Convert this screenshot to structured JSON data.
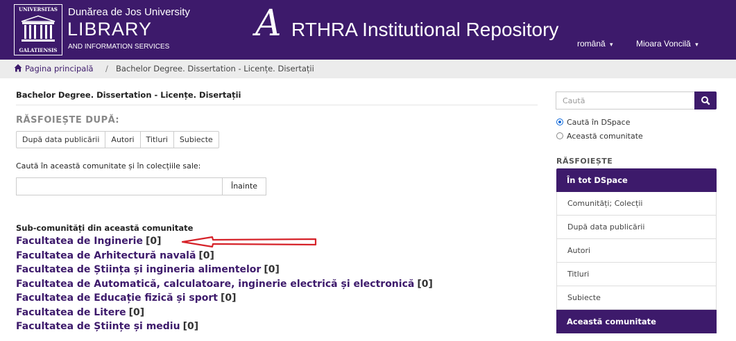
{
  "header": {
    "logo_top": "UNIVERSITAS",
    "logo_bottom": "GALATIENSIS",
    "university": "Dunărea de Jos University",
    "library": "LIBRARY",
    "subtitle": "AND INFORMATION SERVICES",
    "repo_initial": "A",
    "repo_rest": "RTHRA Institutional Repository",
    "language": "română",
    "user": "Mioara Voncilă",
    "caret": "▾"
  },
  "breadcrumb": {
    "home": "Pagina principală",
    "separator": "/",
    "current": "Bachelor Degree. Dissertation - Licențe. Disertații"
  },
  "main": {
    "heading": "Bachelor Degree. Dissertation - Licențe. Disertații",
    "browse_by": "RĂSFOIEȘTE DUPĂ:",
    "browse_buttons": [
      "După data publicării",
      "Autori",
      "Titluri",
      "Subiecte"
    ],
    "search_label": "Caută în această comunitate și în colecțiile sale:",
    "search_value": "",
    "go_label": "Înainte",
    "subcommunities_heading": "Sub-comunități din această comunitate",
    "subcommunities": [
      {
        "name": "Facultatea de Inginerie",
        "count": "[0]"
      },
      {
        "name": "Facultatea de Arhitectură navală",
        "count": "[0]"
      },
      {
        "name": "Facultatea de Știința și ingineria alimentelor",
        "count": "[0]"
      },
      {
        "name": "Facultatea de Automatică, calculatoare, inginerie electrică și electronică",
        "count": "[0]"
      },
      {
        "name": "Facultatea de Educație fizică și sport",
        "count": "[0]"
      },
      {
        "name": "Facultatea de Litere",
        "count": "[0]"
      },
      {
        "name": "Facultatea de Științe și mediu",
        "count": "[0]"
      }
    ]
  },
  "sidebar": {
    "search_placeholder": "Caută",
    "scope_all": "Caută în DSpace",
    "scope_this": "Această comunitate",
    "browse_heading": "RĂSFOIEȘTE",
    "all_dspace": "În tot DSpace",
    "items": [
      "Comunități; Colecții",
      "După data publicării",
      "Autori",
      "Titluri",
      "Subiecte"
    ],
    "this_community": "Această comunitate"
  },
  "colors": {
    "brand": "#3d1a6b",
    "annotation_arrow": "#d6232a"
  },
  "icons": [
    "home-icon",
    "search-icon",
    "caret-down-icon",
    "red-arrow-annotation"
  ]
}
